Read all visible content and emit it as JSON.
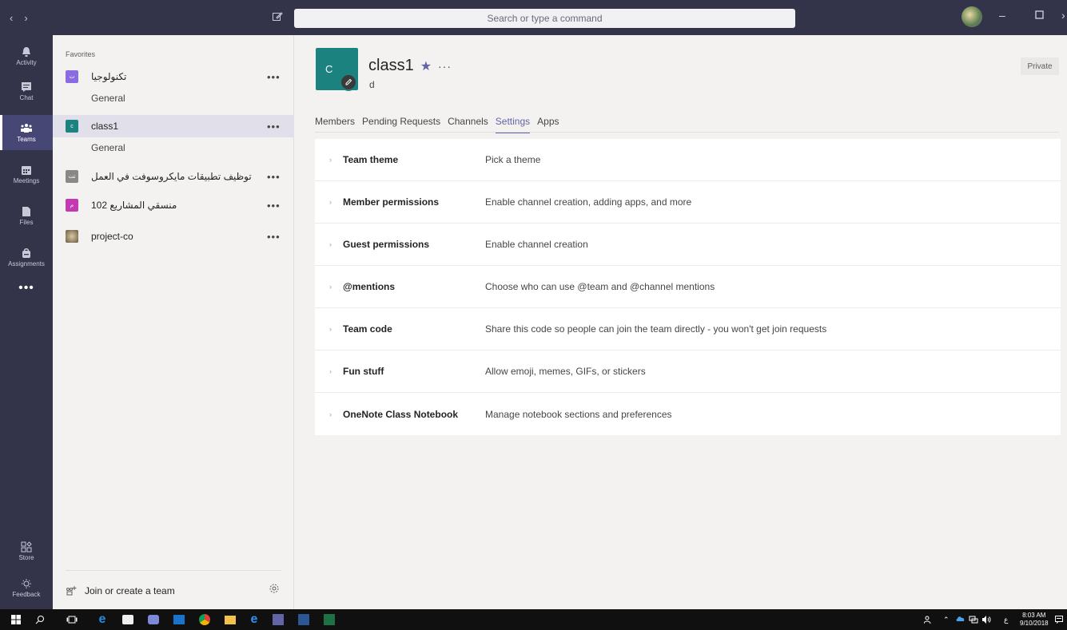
{
  "titlebar": {
    "search_placeholder": "Search or type a command"
  },
  "rail": {
    "items": [
      {
        "label": "Activity",
        "icon": "bell-icon"
      },
      {
        "label": "Chat",
        "icon": "chat-icon"
      },
      {
        "label": "Teams",
        "icon": "teams-icon"
      },
      {
        "label": "Meetings",
        "icon": "calendar-icon"
      },
      {
        "label": "Files",
        "icon": "file-icon"
      },
      {
        "label": "Assignments",
        "icon": "backpack-icon"
      }
    ],
    "more": "•••",
    "store": "Store",
    "feedback": "Feedback"
  },
  "teamlist": {
    "favorites_label": "Favorites",
    "teams": [
      {
        "name": "تكنولوجيا",
        "tile": "ت",
        "color": "#8b6ce0",
        "channel": "General"
      },
      {
        "name": "class1",
        "tile": "c",
        "color": "#1b8280",
        "channel": "General"
      },
      {
        "name": "توظيف تطبيقات مايكروسوفت في العمل",
        "tile": "تت",
        "color": "#8a8886"
      },
      {
        "name": "منسقي المشاريع 102",
        "tile": "م",
        "color": "#c239b3"
      },
      {
        "name": "project-co",
        "tile": "",
        "color": "#7a6a55"
      }
    ],
    "dots": "•••",
    "join_label": "Join or create a team"
  },
  "main": {
    "tile_letter": "C",
    "title": "class1",
    "star": "★",
    "title_dots": "···",
    "subtitle": "d",
    "privacy": "Private",
    "tabs": [
      "Members",
      "Pending Requests",
      "Channels",
      "Settings",
      "Apps"
    ],
    "active_tab": "Settings",
    "settings": [
      {
        "title": "Team theme",
        "desc": "Pick a theme"
      },
      {
        "title": "Member permissions",
        "desc": "Enable channel creation, adding apps, and more"
      },
      {
        "title": "Guest permissions",
        "desc": "Enable channel creation"
      },
      {
        "title": "@mentions",
        "desc": "Choose who can use @team and @channel mentions"
      },
      {
        "title": "Team code",
        "desc": "Share this code so people can join the team directly - you won't get join requests"
      },
      {
        "title": "Fun stuff",
        "desc": "Allow emoji, memes, GIFs, or stickers"
      },
      {
        "title": "OneNote Class Notebook",
        "desc": "Manage notebook sections and preferences"
      }
    ]
  },
  "taskbar": {
    "time": "8:03 AM",
    "date": "9/10/2018",
    "lang": "ع"
  },
  "colors": {
    "rail_bg": "#33344a",
    "accent": "#6264a7",
    "team_tile": "#1b8280"
  }
}
